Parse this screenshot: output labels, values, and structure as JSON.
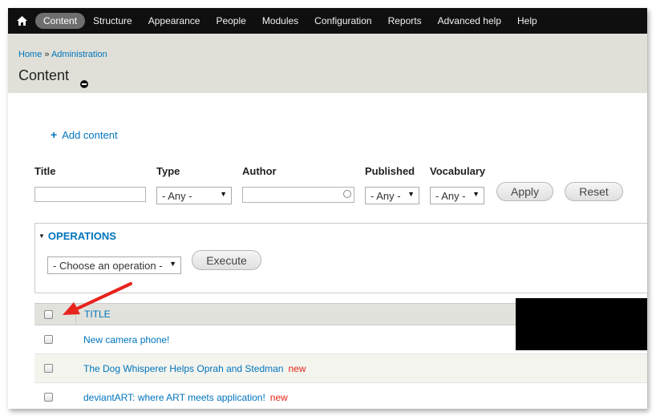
{
  "toolbar": {
    "home_icon": "home-icon",
    "menu": [
      {
        "label": "Content",
        "active": true
      },
      {
        "label": "Structure"
      },
      {
        "label": "Appearance"
      },
      {
        "label": "People"
      },
      {
        "label": "Modules"
      },
      {
        "label": "Configuration"
      },
      {
        "label": "Reports"
      },
      {
        "label": "Advanced help"
      },
      {
        "label": "Help"
      }
    ]
  },
  "header": {
    "breadcrumb": {
      "home": "Home",
      "separator": " » ",
      "admin": "Administration"
    },
    "title": "Content"
  },
  "add_content": {
    "label": "Add content",
    "icon": "plus-icon"
  },
  "filters": {
    "title_label": "Title",
    "title_value": "",
    "type_label": "Type",
    "type_value": "- Any -",
    "author_label": "Author",
    "author_value": "",
    "published_label": "Published",
    "published_value": "- Any -",
    "vocabulary_label": "Vocabulary",
    "vocabulary_value": "- Any -",
    "apply": "Apply",
    "reset": "Reset"
  },
  "operations": {
    "legend": "OPERATIONS",
    "select_value": "- Choose an operation -",
    "execute": "Execute"
  },
  "table": {
    "title_header": "TITLE",
    "rows": [
      {
        "title": "New camera phone!",
        "badge": ""
      },
      {
        "title": "The Dog Whisperer Helps Oprah and Stedman",
        "badge": "new"
      },
      {
        "title": "deviantART: where ART meets application!",
        "badge": "new"
      }
    ]
  },
  "colors": {
    "link": "#0074bd",
    "toolbar": "#0f0f0f",
    "header": "#e0e0d8",
    "new_badge": "#e5241b",
    "annotation_arrow": "#e8231c"
  }
}
